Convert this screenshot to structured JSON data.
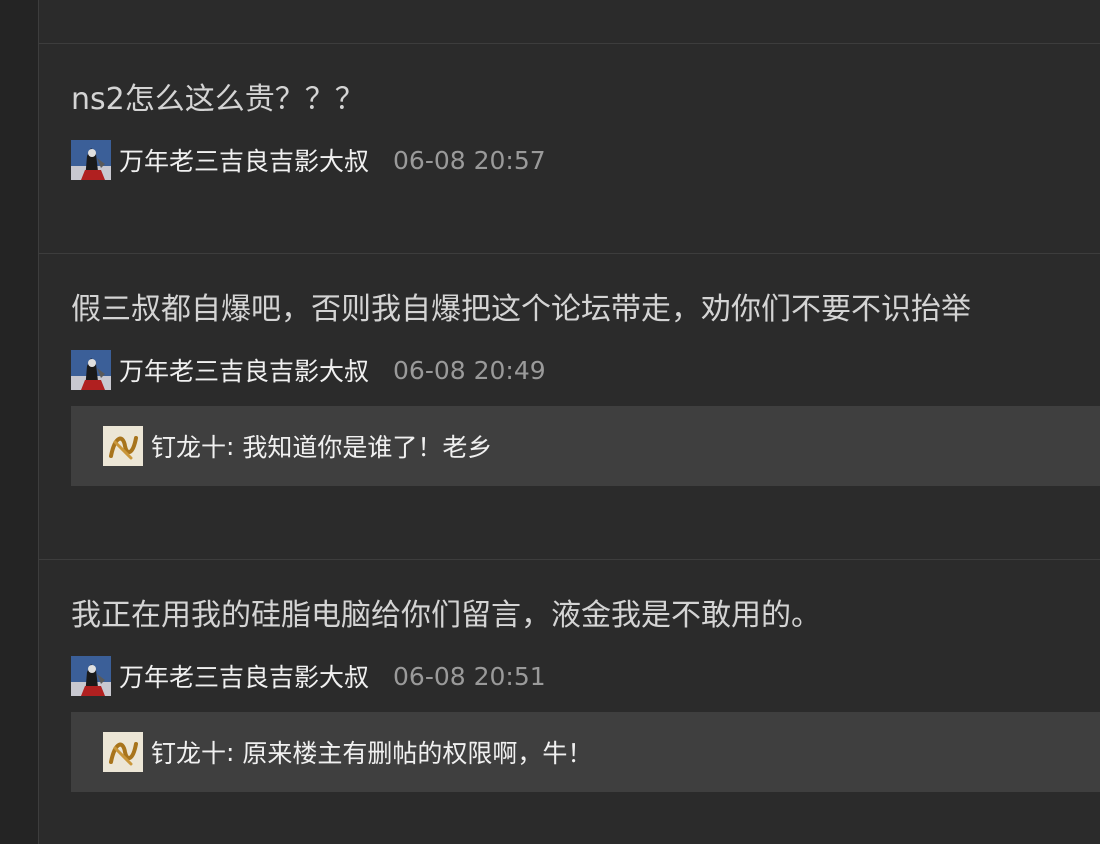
{
  "posts": [
    {
      "text": "ns2怎么这么贵？？？",
      "author": "万年老三吉良吉影大叔",
      "time": "06-08 20:57"
    },
    {
      "text": "假三叔都自爆吧，否则我自爆把这个论坛带走，劝你们不要不识抬举",
      "author": "万年老三吉良吉影大叔",
      "time": "06-08 20:49",
      "reply": {
        "name": "钉龙十",
        "separator": ":",
        "text": " 我知道你是谁了！老乡"
      }
    },
    {
      "text": "我正在用我的硅脂电脑给你们留言，液金我是不敢用的。",
      "author": "万年老三吉良吉影大叔",
      "time": "06-08 20:51",
      "reply": {
        "name": "钉龙十",
        "separator": ":",
        "text": " 原来楼主有删帖的权限啊，牛！"
      }
    }
  ]
}
